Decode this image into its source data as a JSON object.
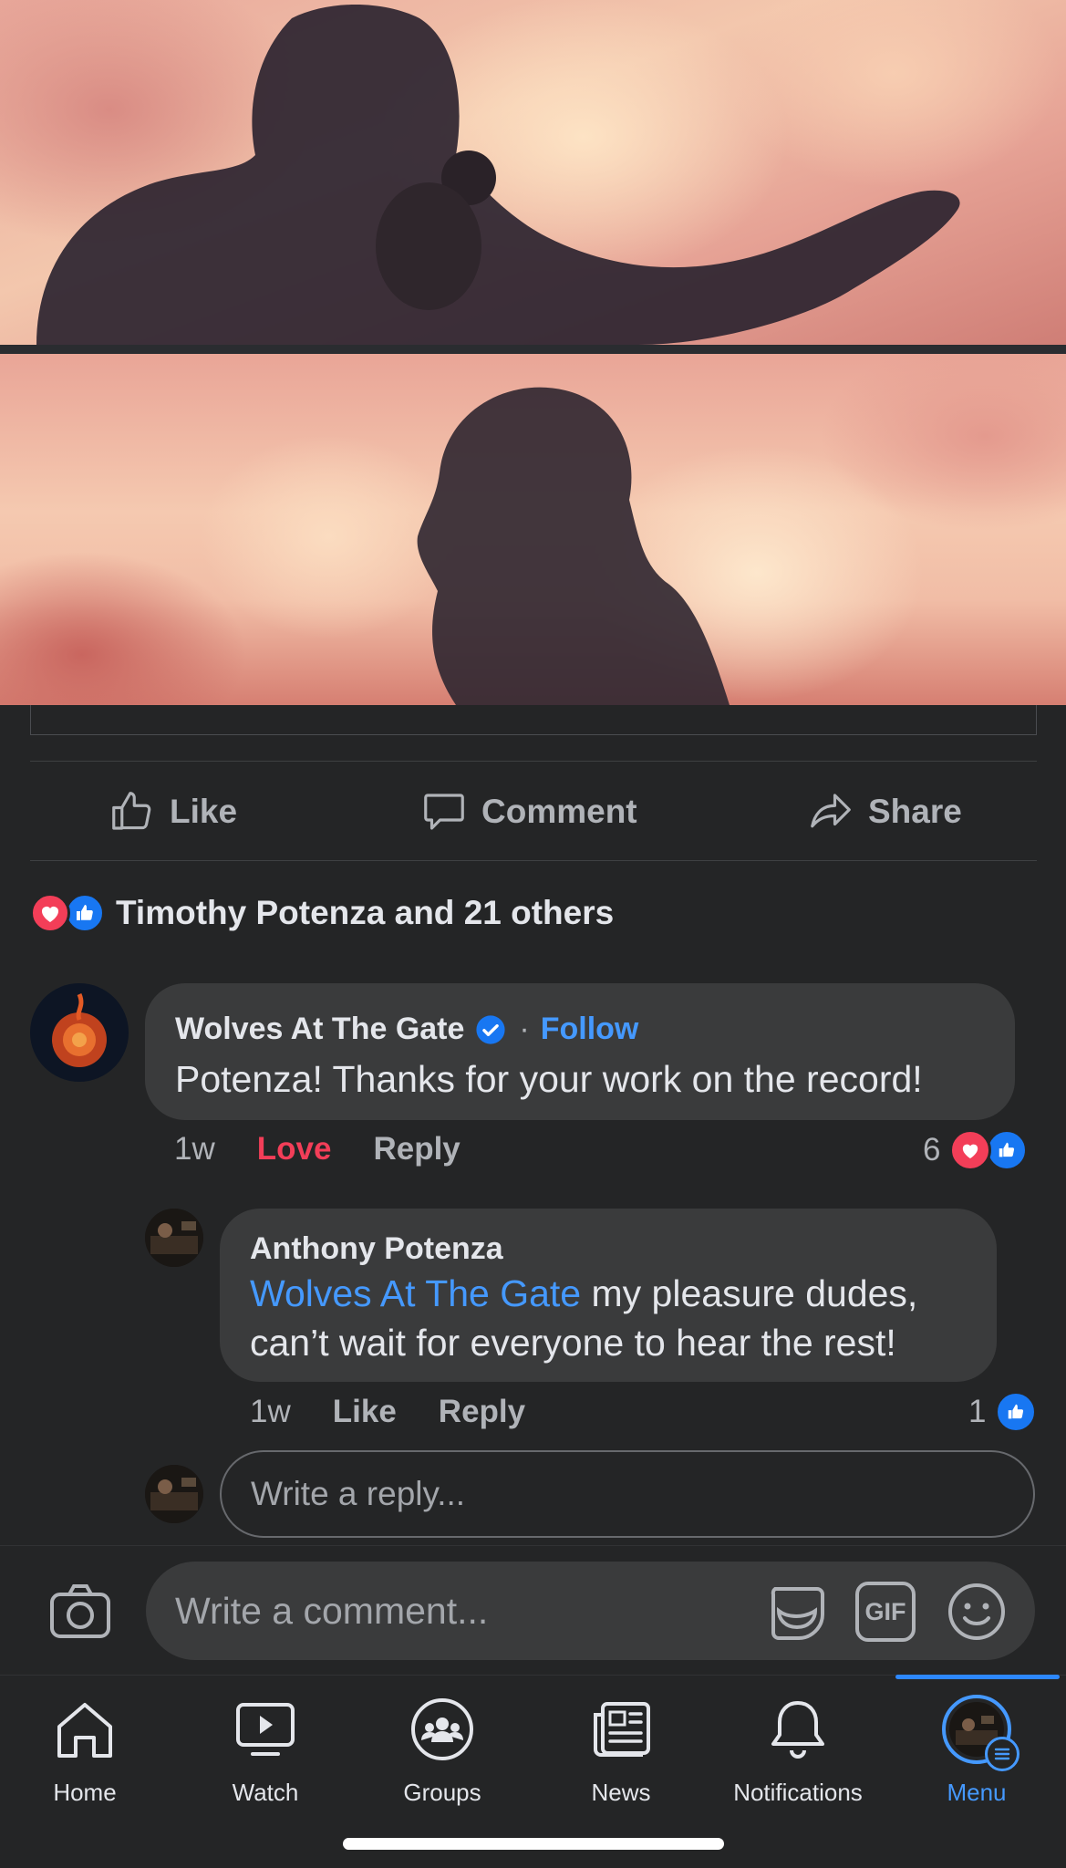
{
  "post": {
    "actions": {
      "like": "Like",
      "comment": "Comment",
      "share": "Share"
    },
    "reactions_summary": "Timothy Potenza and 21 others"
  },
  "comment": {
    "author": "Wolves At The Gate",
    "follow_label": "Follow",
    "separator": "·",
    "text": "Potenza! Thanks for your work on the record!",
    "time": "1w",
    "reaction_label": "Love",
    "reply_label": "Reply",
    "reaction_count": "6"
  },
  "reply": {
    "author": "Anthony Potenza",
    "mention": "Wolves At The Gate",
    "text_line1": " my pleasure dudes,",
    "text_line2": "can’t wait for everyone to hear the rest!",
    "time": "1w",
    "like_label": "Like",
    "reply_label": "Reply",
    "reaction_count": "1"
  },
  "reply_input": {
    "placeholder": "Write a reply..."
  },
  "comment_input": {
    "placeholder": "Write a comment...",
    "gif_label": "GIF"
  },
  "nav": {
    "items": [
      {
        "label": "Home",
        "icon": "home-icon"
      },
      {
        "label": "Watch",
        "icon": "watch-icon"
      },
      {
        "label": "Groups",
        "icon": "groups-icon"
      },
      {
        "label": "News",
        "icon": "news-icon"
      },
      {
        "label": "Notifications",
        "icon": "bell-icon"
      },
      {
        "label": "Menu",
        "icon": "menu-avatar",
        "active": true
      }
    ]
  },
  "colors": {
    "accent": "#4599ff",
    "love": "#f33e58",
    "like": "#1877f2",
    "background": "#242526",
    "bubble": "#3a3b3c"
  }
}
